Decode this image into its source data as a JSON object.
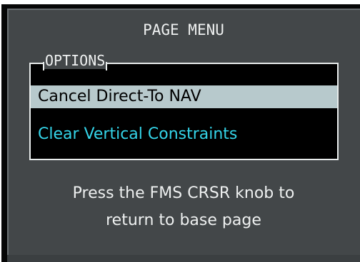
{
  "menu": {
    "title": "PAGE MENU",
    "group_label": "OPTIONS",
    "items": [
      {
        "label": "Cancel Direct-To NAV",
        "selected": true
      },
      {
        "label": "Clear Vertical Constraints",
        "selected": false
      }
    ]
  },
  "hint": {
    "line1": "Press the FMS CRSR knob to",
    "line2": "return to base page"
  },
  "colors": {
    "window_bg": "#434749",
    "selected_bg": "#b7c9cc",
    "option_text": "#34d4e8",
    "text": "#eef0f0"
  }
}
